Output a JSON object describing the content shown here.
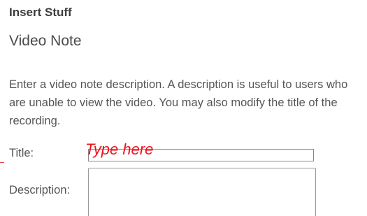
{
  "header": {
    "title": "Insert Stuff"
  },
  "dialog": {
    "title": "Video Note",
    "description": "Enter a video note description. A description is useful to users who are unable to view the video. You may also modify the title of the recording."
  },
  "form": {
    "title_label": "Title:",
    "title_value": "Type here",
    "description_label": "Description:",
    "description_value": ""
  },
  "colors": {
    "typed_text": "#e8141c",
    "label_text": "#555555"
  }
}
